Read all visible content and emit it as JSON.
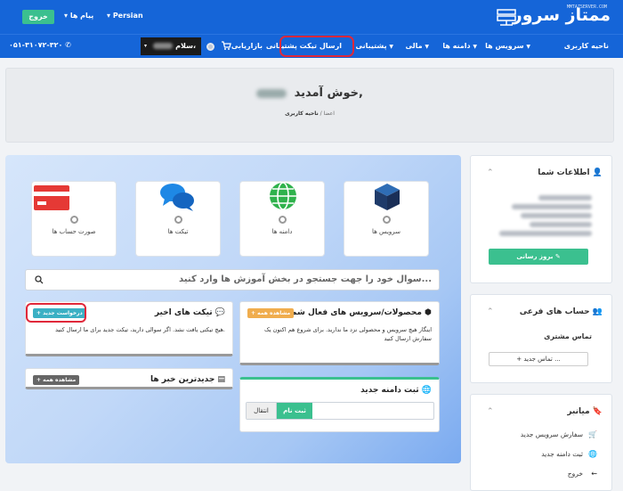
{
  "header": {
    "brand": "ممتاز سرور",
    "brand_sub": "MMTAZSERVER.COM",
    "logout_label": "خروج",
    "messages_label": "پیام ها",
    "language_label": "Persian"
  },
  "nav": {
    "items": [
      {
        "label": "ناحیه کاربری"
      },
      {
        "label": "سرویس ها",
        "caret": "▼"
      },
      {
        "label": "دامنه ها",
        "caret": "▼"
      },
      {
        "label": "مالی",
        "caret": "▼"
      },
      {
        "label": "پشتیبانی",
        "caret": "▼"
      },
      {
        "label": "ارسال تیکت پشتیبانی"
      },
      {
        "label": "بازاریابی"
      }
    ],
    "greeting": "سلام،",
    "phone": "۰۵۱-۳۱۰۷۲-۳۲۰"
  },
  "banner": {
    "title": "خوش آمدید,",
    "crumb_home": "اعضا",
    "crumb_current": "ناحیه کاربری"
  },
  "tiles": [
    {
      "label": "سرویس ها",
      "icon": "box-icon"
    },
    {
      "label": "دامنه ها",
      "icon": "globe-icon"
    },
    {
      "label": "تیکت ها",
      "icon": "chat-icon"
    },
    {
      "label": "صورت حساب ها",
      "icon": "card-icon"
    }
  ],
  "search": {
    "placeholder": "سوال خود را جهت جستجو در بخش آموزش ها وارد کنید..."
  },
  "cards": {
    "tickets": {
      "title": "تیکت های اخیر",
      "badge": "+ درخواست جدید",
      "body": "هیچ تیکتی یافت نشد. اگر سوالی دارید، تیکت جدید برای ما ارسال کنید."
    },
    "products": {
      "title": "محصولات/سرویس های فعال شما",
      "badge": "+ مشاهده همه",
      "body": "اینگار هیچ سرویس و محصولی نزد ما ندارید. برای شروع هم اکنون یک سفارش ارسال کنید"
    },
    "news": {
      "title": "جدیدترین خبر ها",
      "badge": "+ مشاهده همه"
    },
    "domain": {
      "title": "ثبت دامنه جدید",
      "register": "ثبت نام",
      "transfer": "انتقال"
    }
  },
  "sidebar": {
    "info": {
      "title": "اطلاعات شما",
      "update": "بروز رسانی"
    },
    "subaccounts": {
      "title": "حساب های فرعی",
      "contact": "تماس مشتری",
      "new_contact": "+ تماس جدید ..."
    },
    "shortcuts": {
      "title": "میانبر",
      "items": [
        {
          "label": "سفارش سرویس جدید",
          "icon": "cart-icon"
        },
        {
          "label": "ثبت دامنه جدید",
          "icon": "globe-icon"
        },
        {
          "label": "خروج",
          "icon": "arrow-left-icon"
        }
      ]
    }
  },
  "colors": {
    "primary": "#1565d8",
    "accent": "#3bc08f",
    "highlight": "#e0283a"
  }
}
